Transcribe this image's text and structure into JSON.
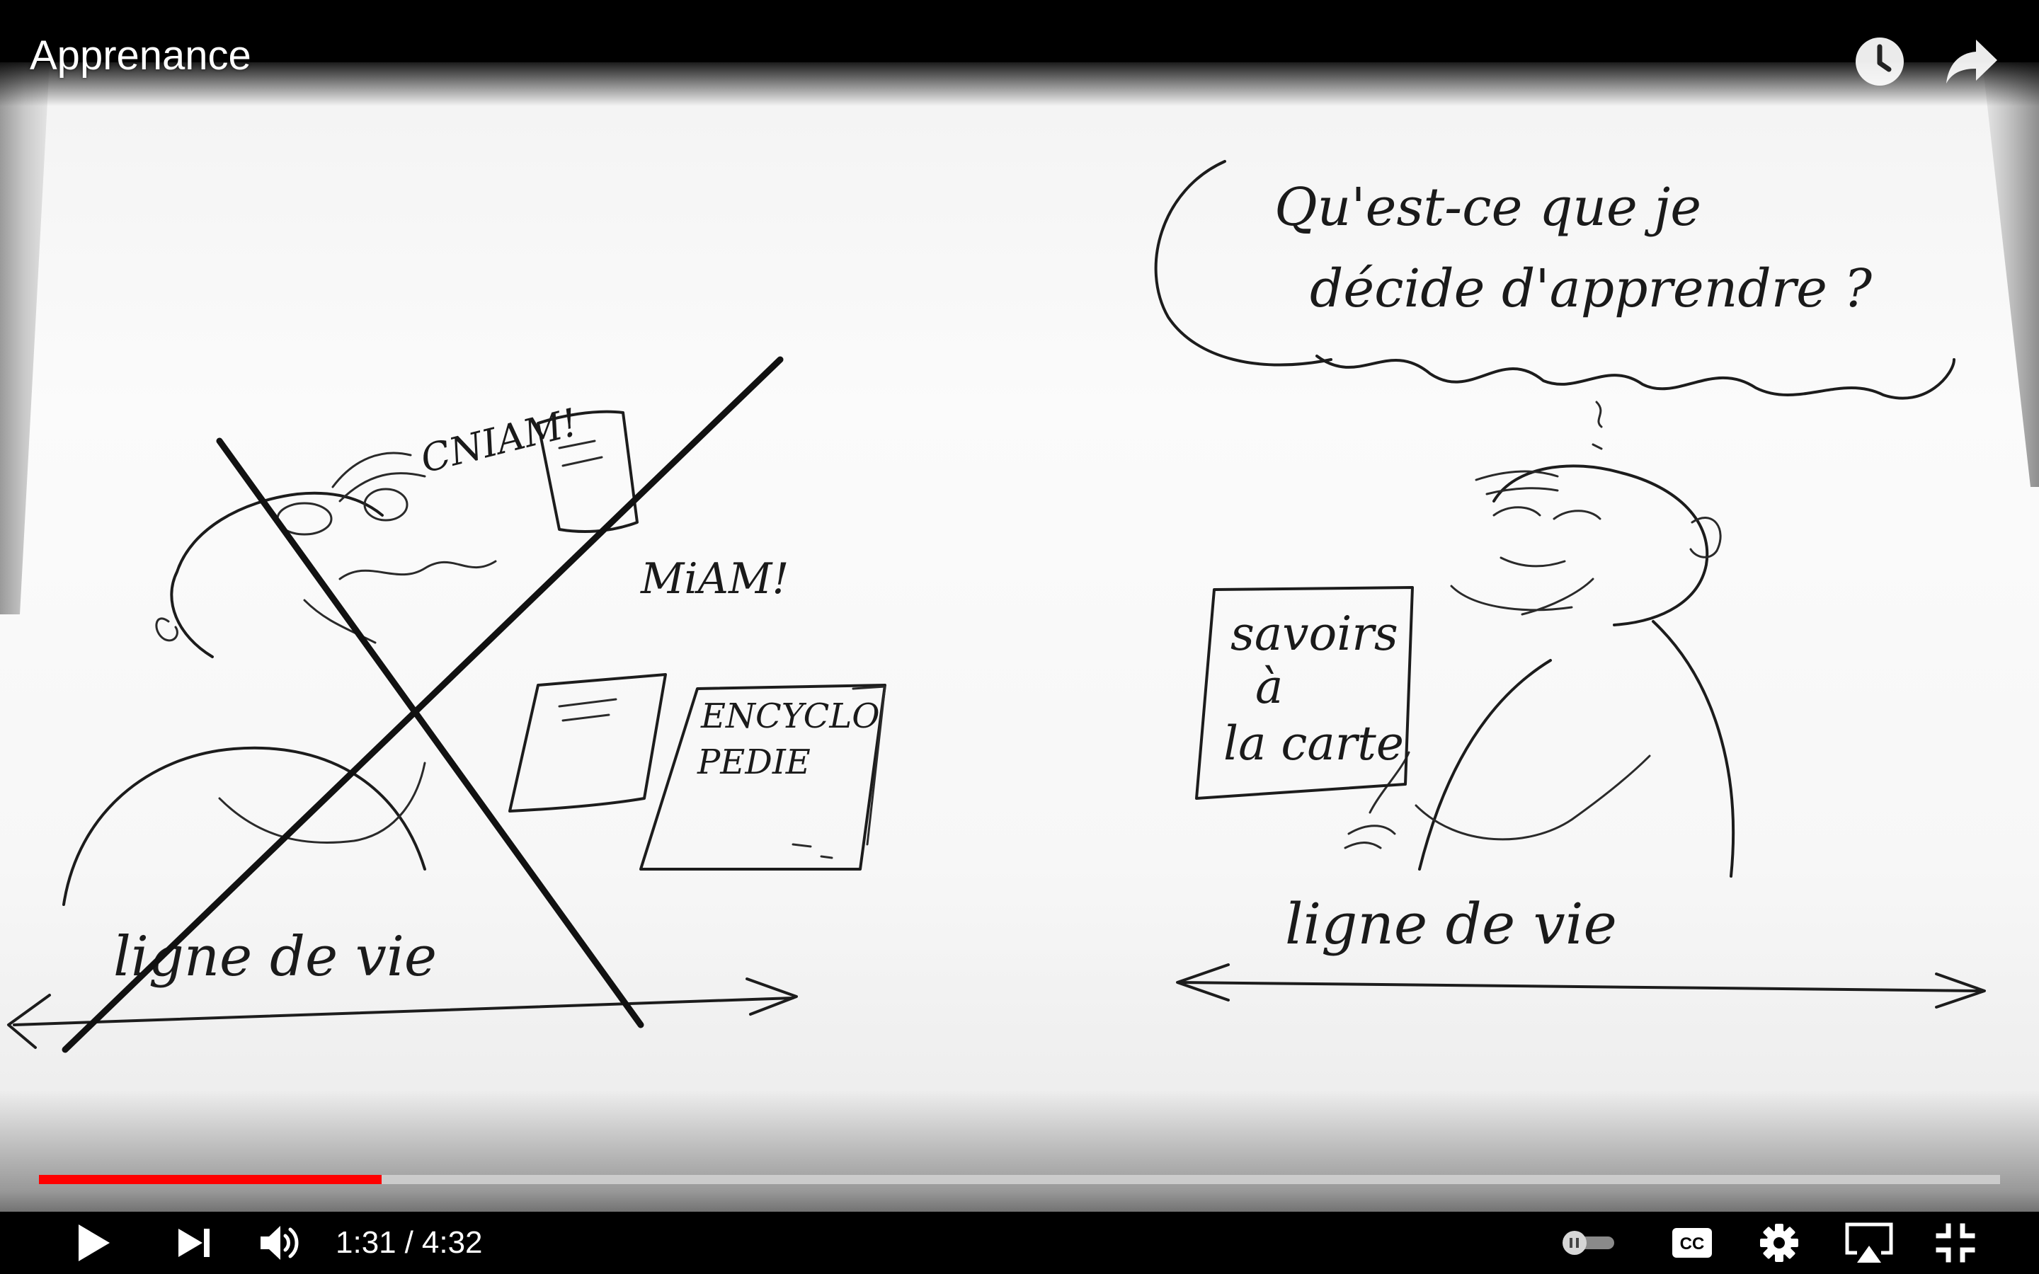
{
  "player": {
    "title": "Apprenance",
    "progress_fraction": 0.1746,
    "time": {
      "current": "1:31",
      "separator": "/",
      "duration": "4:32"
    },
    "colors": {
      "played": "#ff0000",
      "control_bar": "#000000",
      "icons": "#ffffff"
    },
    "icons": {
      "watch_later": "clock-icon",
      "share": "share-arrow-icon",
      "play": "play-icon",
      "next": "skip-next-icon",
      "volume": "speaker-icon",
      "autoplay": "autoplay-toggle-icon",
      "captions": "cc-icon",
      "settings": "gear-icon",
      "airplay": "airplay-icon",
      "exit_fullscreen": "exit-fullscreen-icon"
    }
  },
  "whiteboard": {
    "left": {
      "exclaim_1": "CNIAM!",
      "exclaim_2": "MiAM!",
      "book_line_1": "ENCYCLO",
      "book_line_2": "PEDIE",
      "timeline_label": "ligne de vie"
    },
    "right": {
      "question_line_1": "Qu'est-ce que je",
      "question_line_2": "décide d'apprendre ?",
      "menu_line_1": "savoirs",
      "menu_line_2": "à",
      "menu_line_3": "la carte",
      "timeline_label": "ligne de vie"
    }
  }
}
